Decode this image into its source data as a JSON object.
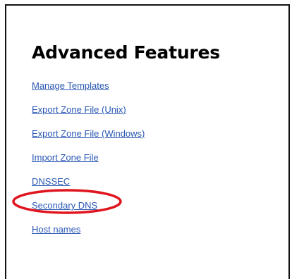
{
  "page": {
    "title": "Advanced Features"
  },
  "links": [
    {
      "label": "Manage Templates"
    },
    {
      "label": "Export Zone File (Unix)"
    },
    {
      "label": "Export Zone File (Windows)"
    },
    {
      "label": "Import Zone File"
    },
    {
      "label": "DNSSEC"
    },
    {
      "label": "Secondary DNS"
    },
    {
      "label": "Host names"
    }
  ],
  "annotation": {
    "highlighted_item": "Secondary DNS",
    "color": "#e0141e"
  },
  "colors": {
    "link": "#2a58b3",
    "title": "#000000",
    "border": "#111111"
  }
}
